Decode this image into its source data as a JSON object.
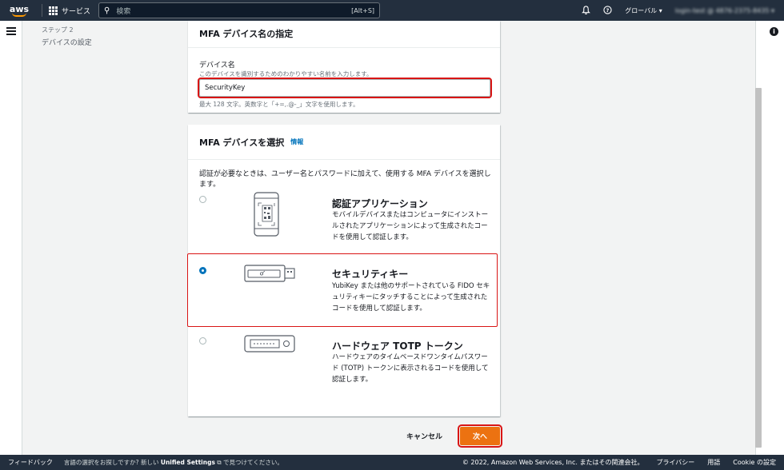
{
  "topbar": {
    "logo": "aws",
    "services_label": "サービス",
    "search_placeholder": "検索",
    "search_shortcut": "[Alt+S]",
    "region_label": "グローバル ▾",
    "account": "login-test @ 4876-2375-8435 ▾"
  },
  "steps": {
    "step_label": "ステップ 2",
    "step_title": "デバイスの設定"
  },
  "name_section": {
    "title": "MFA デバイス名の指定",
    "field_label": "デバイス名",
    "field_desc": "このデバイスを識別するためのわかりやすい名前を入力します。",
    "field_value": "SecurityKey",
    "hint": "最大 128 文字。英数字と「+=,.@-_」文字を使用します。"
  },
  "device_section": {
    "title": "MFA デバイスを選択",
    "info_link": "情報",
    "intro": "認証が必要なときは、ユーザー名とパスワードに加えて、使用する MFA デバイスを選択します。",
    "options": [
      {
        "title": "認証アプリケーション",
        "desc": "モバイルデバイスまたはコンピュータにインストールされたアプリケーションによって生成されたコードを使用して認証します。",
        "selected": false
      },
      {
        "title": "セキュリティキー",
        "desc": "YubiKey または他のサポートされている FIDO セキュリティキーにタッチすることによって生成されたコードを使用して認証します。",
        "selected": true
      },
      {
        "title": "ハードウェア TOTP トークン",
        "desc": "ハードウェアのタイムベースドワンタイムパスワード (TOTP) トークンに表示されるコードを使用して認証します。",
        "selected": false
      }
    ]
  },
  "actions": {
    "cancel": "キャンセル",
    "next": "次へ"
  },
  "footer": {
    "feedback": "フィードバック",
    "note_prefix": "言語の選択をお探しですか? 新しい",
    "note_link": "Unified Settings",
    "note_suffix": "で見つけてください。",
    "copyright": "© 2022, Amazon Web Services, Inc. またはその関連会社。",
    "privacy": "プライバシー",
    "terms": "用語",
    "cookie": "Cookie の設定"
  },
  "colors": {
    "accent": "#ec7211",
    "link": "#0073bb",
    "highlight": "#d91515"
  }
}
